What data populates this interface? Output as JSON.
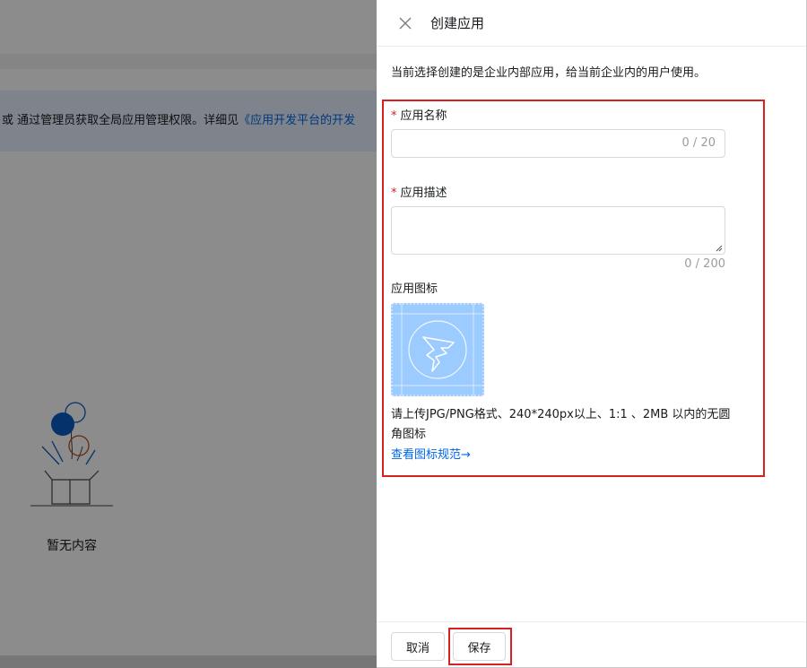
{
  "background": {
    "notice_text": "或 通过管理员获取全局应用管理权限。详细见",
    "notice_link": "《应用开发平台的开发",
    "empty_text": "暂无内容"
  },
  "drawer": {
    "title": "创建应用",
    "intro": "当前选择创建的是企业内部应用，给当前企业内的用户使用。",
    "fields": {
      "name_label": "应用名称",
      "name_value": "",
      "name_counter": "0 / 20",
      "desc_label": "应用描述",
      "desc_value": "",
      "desc_counter": "0 / 200",
      "icon_label": "应用图标",
      "required_mark": "*"
    },
    "icon_hint": "请上传JPG/PNG格式、240*240px以上、1:1 、2MB 以内的无圆角图标",
    "spec_link": "查看图标规范→",
    "footer": {
      "cancel_label": "取消",
      "save_label": "保存"
    }
  },
  "colors": {
    "accent": "#0066e6",
    "highlight": "#d91f1f",
    "icon_tile": "#9ccbff"
  },
  "icons": [
    "close-icon",
    "app-icon-placeholder",
    "empty-box-illustration",
    "resize-grip-icon"
  ]
}
